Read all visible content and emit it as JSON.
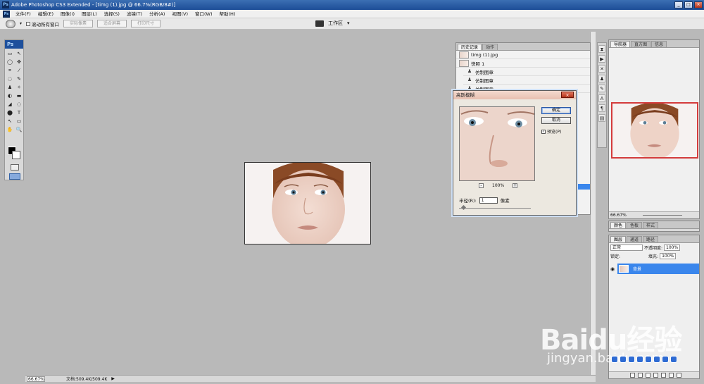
{
  "window": {
    "title": "Adobe Photoshop CS3 Extended - [timg (1).jpg @ 66.7%(RGB/8#)]",
    "logo": "Ps",
    "controls": [
      "_",
      "□",
      "×"
    ]
  },
  "menubar": {
    "items": [
      "文件(F)",
      "编辑(E)",
      "图像(I)",
      "图层(L)",
      "选择(S)",
      "滤镜(T)",
      "分析(A)",
      "视图(V)",
      "窗口(W)",
      "帮助(H)"
    ]
  },
  "options_bar": {
    "scroll_all_windows": "滚动所有窗口",
    "actual_pixels": "实际像素",
    "fit_screen": "适合屏幕",
    "print_size": "打印尺寸",
    "workspace": "工作区"
  },
  "toolbox": {
    "logo": "Ps",
    "tools": [
      "▭",
      "↖",
      "◯",
      "✥",
      "⌗",
      "⁄",
      "◌",
      "✎",
      "♟",
      "✧",
      "◐",
      "▬",
      "◢",
      "◌",
      "⬤",
      "T",
      "↖",
      "▭",
      "✋",
      "🔍"
    ]
  },
  "history_panel": {
    "tabs": [
      "历史记录",
      "动作"
    ],
    "source": "timg (1).jpg",
    "snapshot": "快照 1",
    "steps": [
      "仿制图章",
      "仿制图章",
      "仿制图章"
    ]
  },
  "dialog": {
    "title": "高斯模糊",
    "close": "×",
    "ok": "确定",
    "cancel": "取消",
    "preview_label": "预览(P)",
    "preview_checked": true,
    "zoom": "100%",
    "zoom_minus": "-",
    "zoom_plus": "+",
    "radius_label": "半径(R):",
    "radius_value": "1",
    "radius_unit": "像素"
  },
  "navigator_panel": {
    "tabs": [
      "导航器",
      "直方图",
      "信息"
    ],
    "zoom": "66.67%"
  },
  "color_panel": {
    "tabs": [
      "颜色",
      "色板",
      "样式"
    ]
  },
  "layers_panel": {
    "tabs": [
      "图层",
      "通道",
      "路径"
    ],
    "blend_mode": "正常",
    "opacity_label": "不透明度:",
    "opacity": "100%",
    "lock_label": "锁定:",
    "fill_label": "填充:",
    "fill": "100%",
    "layer_name": "背景"
  },
  "statusbar": {
    "zoom": "66.67%",
    "doc": "文档:509.4K/509.4K"
  },
  "watermark": {
    "brand": "Baidu经验",
    "url": "jingyan.baidu.com"
  },
  "colors": {
    "canvas_bg": "#b9b9b9",
    "title_bar": "#1d4d97",
    "layer_selected": "#3a86ec",
    "navigator_frame": "#d43c3c"
  }
}
